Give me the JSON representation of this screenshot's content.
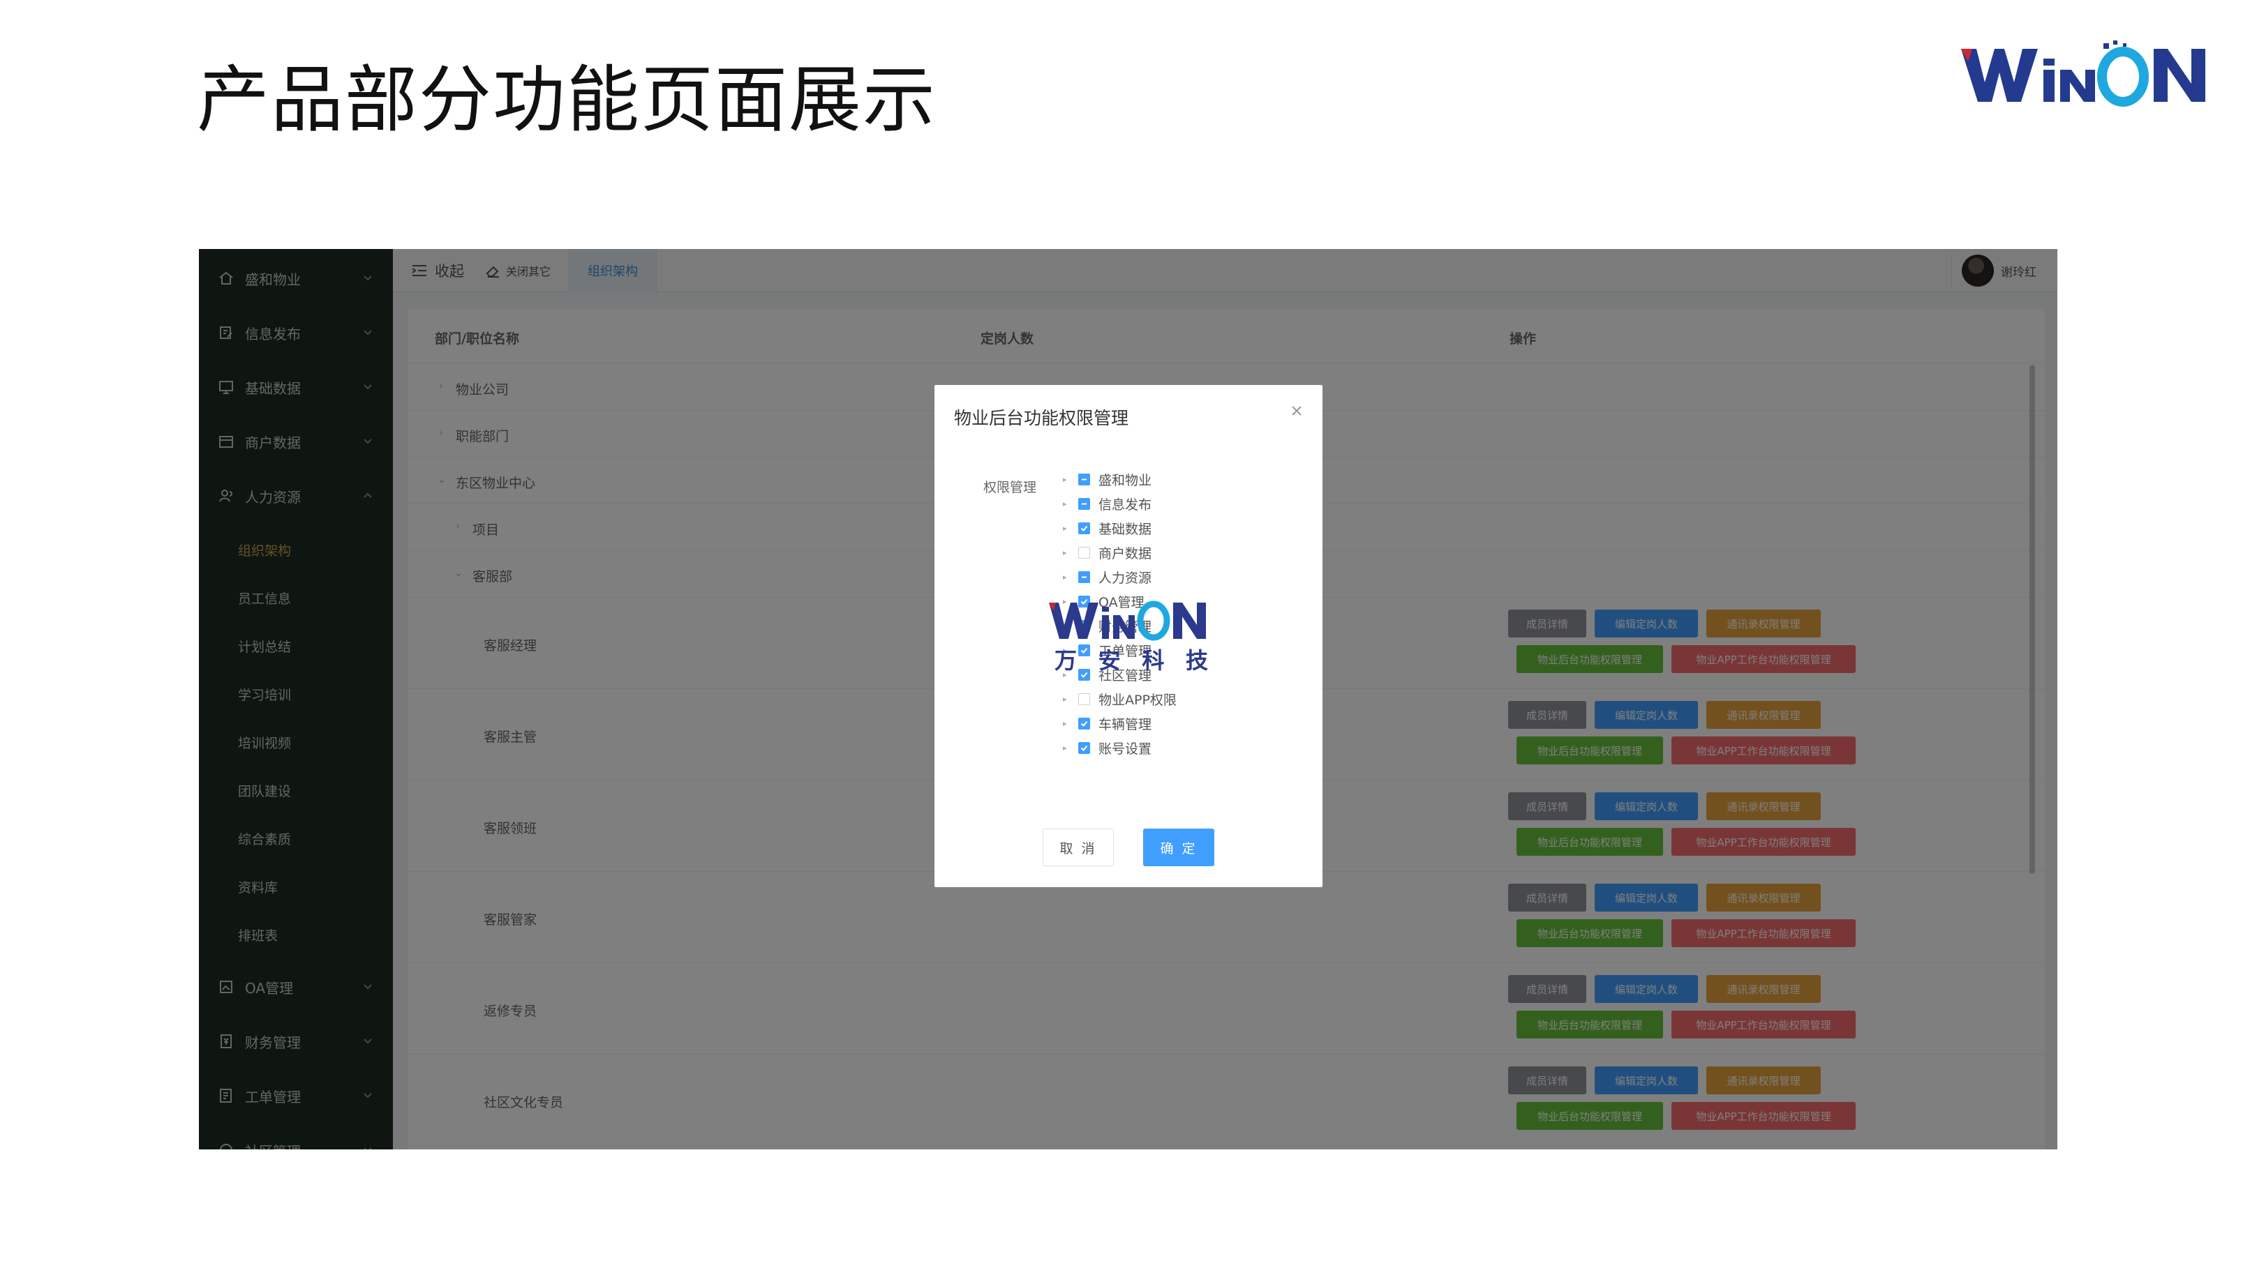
{
  "slide": {
    "title": "产品部分功能页面展示",
    "logo_text": "WiNON"
  },
  "sidebar": {
    "items": [
      {
        "label": "盛和物业",
        "icon": "home-icon"
      },
      {
        "label": "信息发布",
        "icon": "edit-icon"
      },
      {
        "label": "基础数据",
        "icon": "monitor-icon"
      },
      {
        "label": "商户数据",
        "icon": "store-icon"
      },
      {
        "label": "人力资源",
        "icon": "users-icon",
        "expanded": true
      },
      {
        "label": "OA管理",
        "icon": "image-icon"
      },
      {
        "label": "财务管理",
        "icon": "finance-icon"
      },
      {
        "label": "工单管理",
        "icon": "document-icon"
      },
      {
        "label": "社区管理",
        "icon": "community-icon"
      }
    ],
    "sub_items": [
      "组织架构",
      "员工信息",
      "计划总结",
      "学习培训",
      "培训视频",
      "团队建设",
      "综合素质",
      "资料库",
      "排班表"
    ],
    "active_sub": "组织架构"
  },
  "topbar": {
    "collapse_label": "收起",
    "close_others_label": "关闭其它",
    "active_tab": "组织架构",
    "user_name": "谢玲红"
  },
  "table": {
    "headers": [
      "部门/职位名称",
      "定岗人数",
      "操作"
    ],
    "tree_rows": [
      {
        "label": "物业公司",
        "expanded": false
      },
      {
        "label": "职能部门",
        "expanded": false
      },
      {
        "label": "东区物业中心",
        "expanded": true
      },
      {
        "label": "项目",
        "expanded": false
      },
      {
        "label": "客服部",
        "expanded": true
      }
    ],
    "position_rows": [
      "客服经理",
      "客服主管",
      "客服领班",
      "客服管家",
      "返修专员",
      "社区文化专员"
    ],
    "action_buttons": {
      "detail": "成员详情",
      "edit_quota": "编辑定岗人数",
      "contacts_perm": "通讯录权限管理",
      "backend_perm": "物业后台功能权限管理",
      "app_perm": "物业APP工作台功能权限管理"
    }
  },
  "dialog": {
    "title": "物业后台功能权限管理",
    "field_label": "权限管理",
    "tree": [
      {
        "label": "盛和物业",
        "state": "indeterminate"
      },
      {
        "label": "信息发布",
        "state": "indeterminate"
      },
      {
        "label": "基础数据",
        "state": "checked"
      },
      {
        "label": "商户数据",
        "state": "unchecked"
      },
      {
        "label": "人力资源",
        "state": "indeterminate"
      },
      {
        "label": "OA管理",
        "state": "checked"
      },
      {
        "label": "财务管理",
        "state": "checked"
      },
      {
        "label": "工单管理",
        "state": "checked"
      },
      {
        "label": "社区管理",
        "state": "checked"
      },
      {
        "label": "物业APP权限",
        "state": "unchecked"
      },
      {
        "label": "车辆管理",
        "state": "checked"
      },
      {
        "label": "账号设置",
        "state": "checked"
      }
    ],
    "cancel_label": "取 消",
    "ok_label": "确 定",
    "watermark_text": "WiNON",
    "watermark_cn": [
      "万",
      "安",
      "科",
      "技"
    ]
  },
  "colors": {
    "sidebar_bg": "#1f2d24",
    "active_menu": "#c8a24a",
    "primary": "#409eff",
    "gray_btn": "#909399",
    "orange_btn": "#e6a23c",
    "green_btn": "#67c23a",
    "red_btn": "#f56c6c",
    "logo_navy": "#233a8f",
    "logo_red": "#d22630",
    "logo_cyan": "#1fa8e0"
  }
}
